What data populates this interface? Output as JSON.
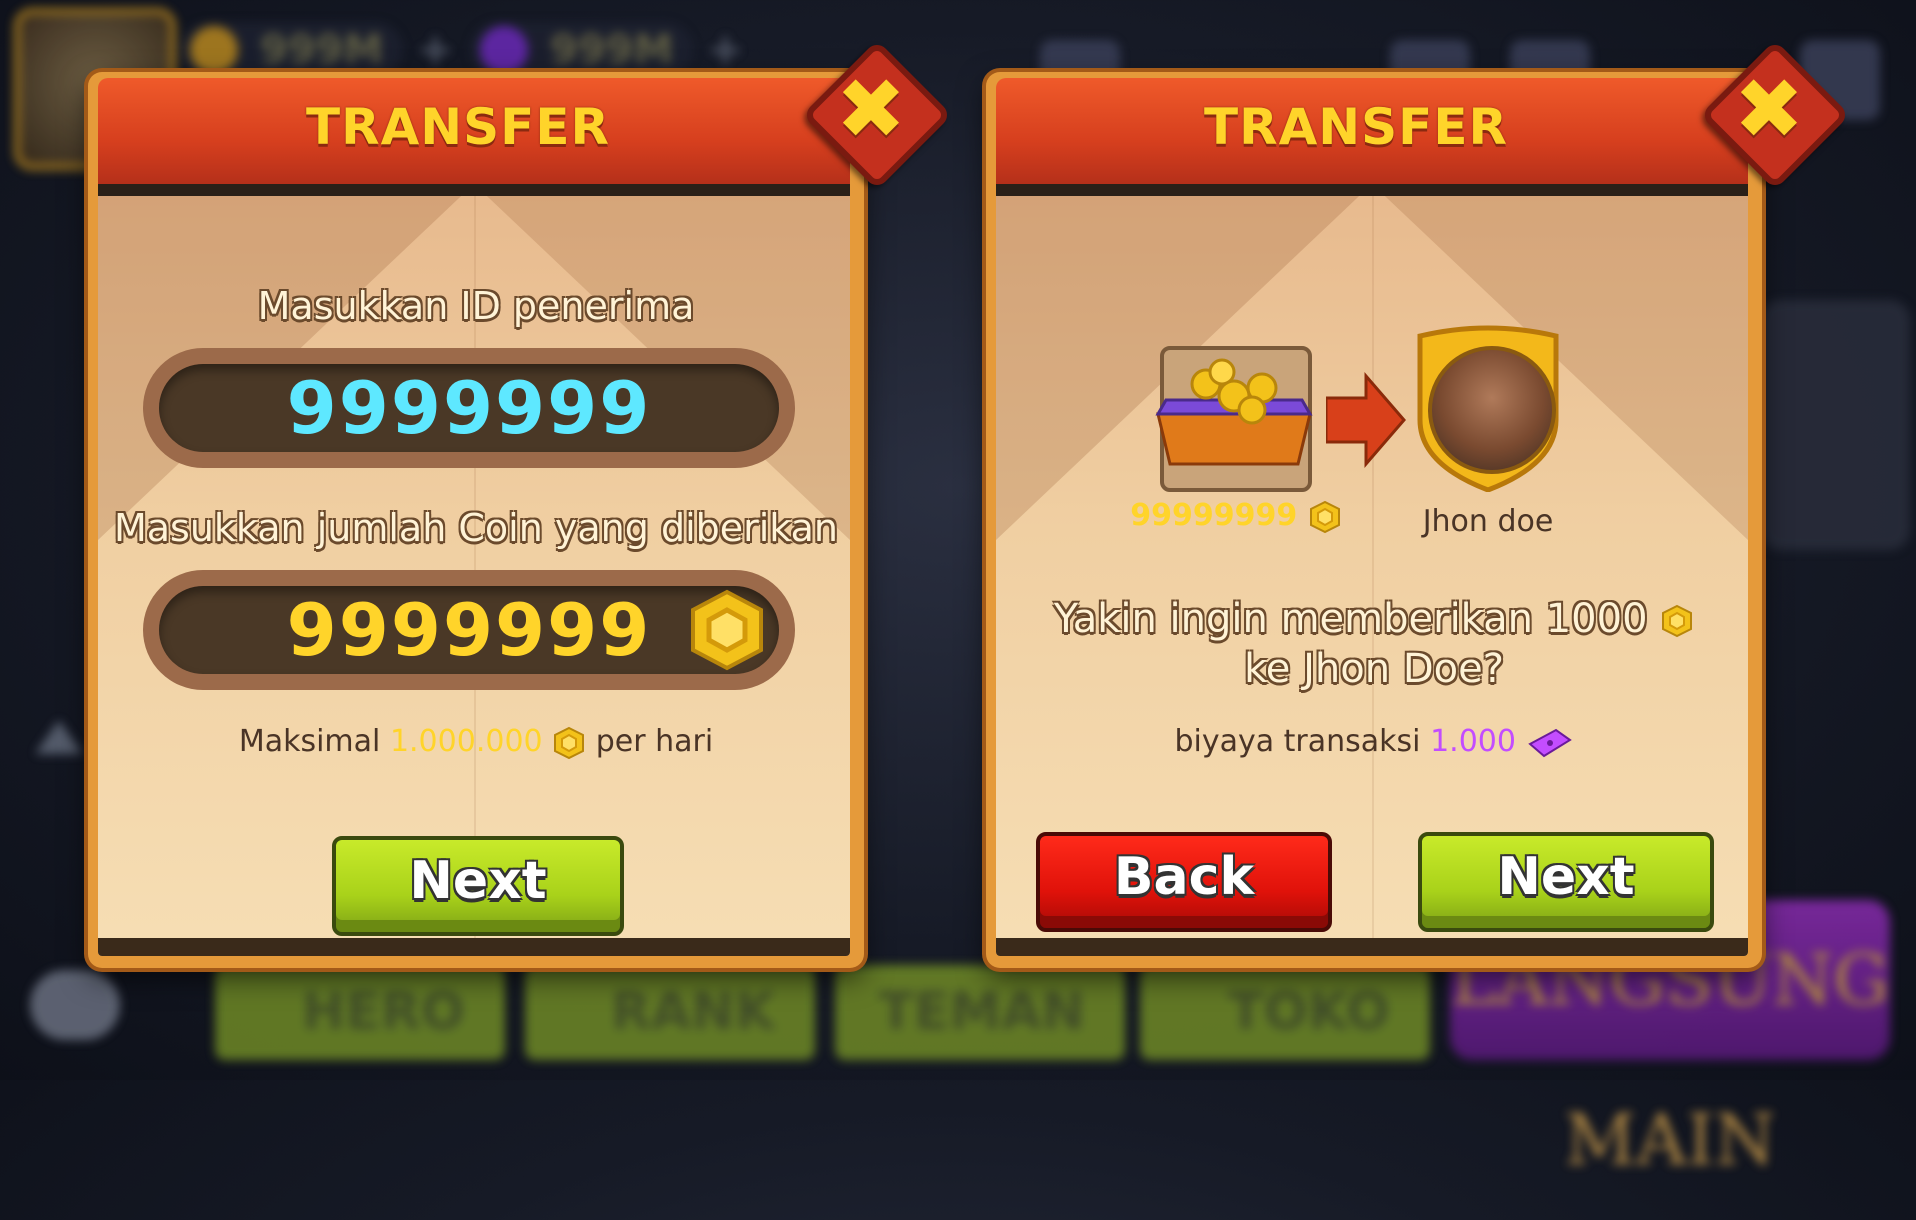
{
  "background": {
    "coins_value": "999M",
    "gems_value": "999M",
    "nav": [
      "HERO",
      "RANK",
      "TEMAN",
      "TOKO"
    ],
    "main_button": "LANGSUNG MAIN"
  },
  "left_dialog": {
    "title": "TRANSFER",
    "recipient_label": "Masukkan ID penerima",
    "recipient_id": "9999999",
    "amount_label": "Masukkan jumlah Coin yang diberikan",
    "amount_value": "9999999",
    "limit_prefix": "Maksimal",
    "limit_value": "1.000.000",
    "limit_suffix": "per hari",
    "next_label": "Next"
  },
  "right_dialog": {
    "title": "TRANSFER",
    "sent_amount": "99999999",
    "recipient_name": "Jhon doe",
    "confirm_line1": "Yakin ingin memberikan 1000",
    "confirm_line2": "ke Jhon Doe?",
    "fee_prefix": "biyaya transaksi",
    "fee_value": "1.000",
    "back_label": "Back",
    "next_label": "Next"
  },
  "colors": {
    "accent_yellow": "#ffd42a",
    "id_cyan": "#5ee8ff",
    "amount_yellow": "#ffd42a",
    "fee_purple": "#c34dff",
    "header_red": "#d63f1e"
  },
  "icons": {
    "close": "close-x-icon",
    "coin": "coin-icon",
    "ticket": "ticket-icon",
    "arrow": "arrow-right-icon",
    "chest": "coin-chest-icon"
  }
}
